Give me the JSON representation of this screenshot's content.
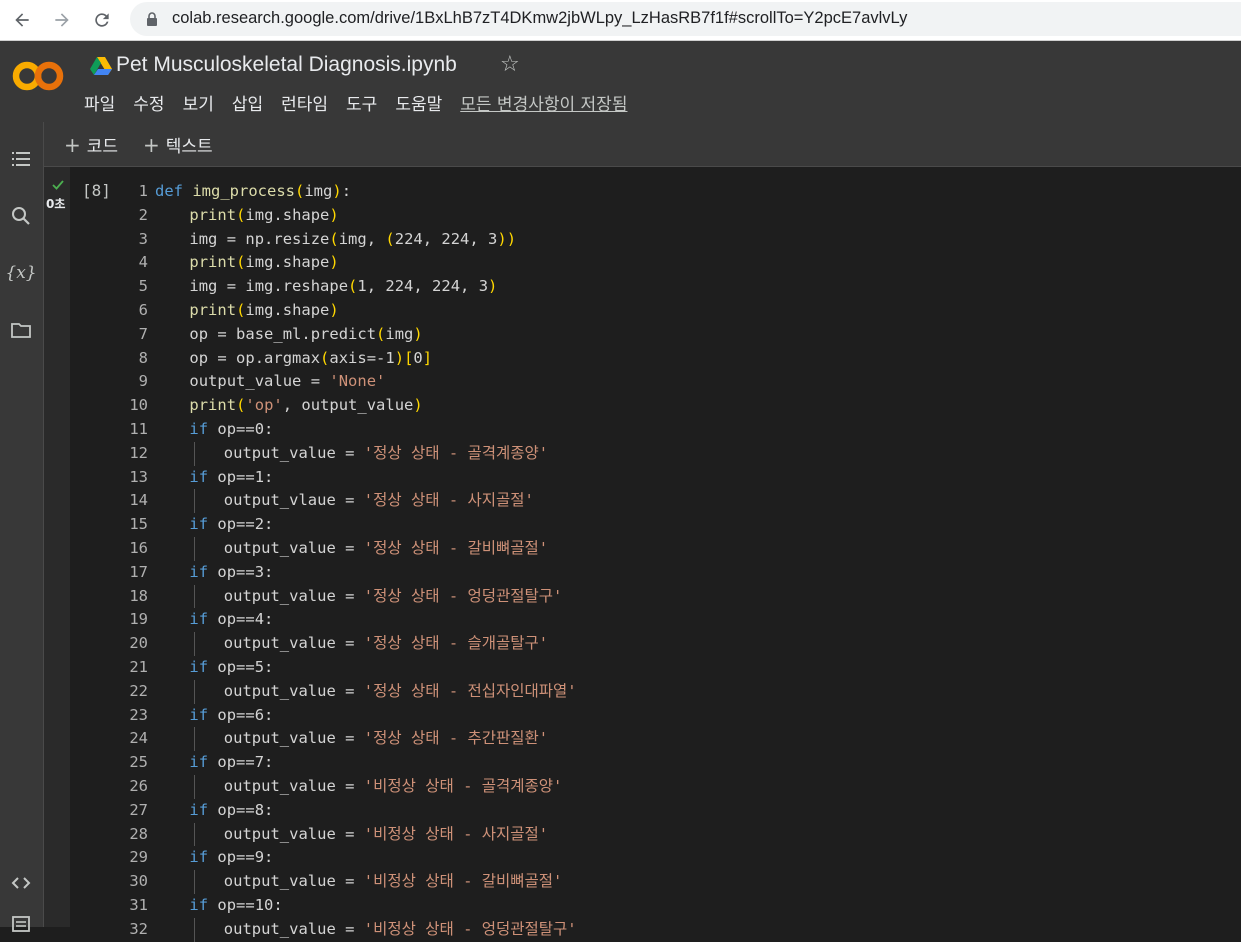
{
  "browser": {
    "url": "colab.research.google.com/drive/1BxLhB7zT4DKmw2jbWLpy_LzHasRB7f1f#scrollTo=Y2pcE7avlvLy"
  },
  "header": {
    "logo_text": "CO",
    "title": "Pet Musculoskeletal Diagnosis.ipynb",
    "menu": [
      "파일",
      "수정",
      "보기",
      "삽입",
      "런타임",
      "도구",
      "도움말"
    ],
    "save_status": "모든 변경사항이 저장됨"
  },
  "toolbar": {
    "add_code": "코드",
    "add_text": "텍스트"
  },
  "cell": {
    "exec_count": "[8]",
    "exec_time": "0초",
    "lines": [
      "def img_process(img):",
      "print(img.shape)",
      "img = np.resize(img, (224, 224, 3))",
      "print(img.shape)",
      "img = img.reshape(1, 224, 224, 3)",
      "print(img.shape)",
      "op = base_ml.predict(img)",
      "op = op.argmax(axis=-1)[0]",
      "output_value = 'None'",
      "print('op', output_value)",
      "if op==0:",
      "output_value = '정상 상태 - 골격계종양'",
      "if op==1:",
      "output_vlaue = '정상 상태 - 사지골절'",
      "if op==2:",
      "output_value = '정상 상태 - 갈비뼈골절'",
      "if op==3:",
      "output_value = '정상 상태 - 엉덩관절탈구'",
      "if op==4:",
      "output_value = '정상 상태 - 슬개골탈구'",
      "if op==5:",
      "output_value = '정상 상태 - 전십자인대파열'",
      "if op==6:",
      "output_value = '정상 상태 - 추간판질환'",
      "if op==7:",
      "output_value = '비정상 상태 - 골격계종양'",
      "if op==8:",
      "output_value = '비정상 상태 - 사지골절'",
      "if op==9:",
      "output_value = '비정상 상태 - 갈비뼈골절'",
      "if op==10:",
      "output_value = '비정상 상태 - 엉덩관절탈구'"
    ]
  },
  "colors": {
    "keyword": "#569cd6",
    "function": "#dcdcaa",
    "string": "#ce9178",
    "success": "#4caf50"
  },
  "icons": [
    "back-arrow-icon",
    "forward-arrow-icon",
    "reload-icon",
    "lock-icon",
    "drive-icon",
    "star-icon",
    "toc-icon",
    "search-icon",
    "variables-icon",
    "folder-icon",
    "code-snippets-icon",
    "terminal-icon",
    "check-icon"
  ]
}
